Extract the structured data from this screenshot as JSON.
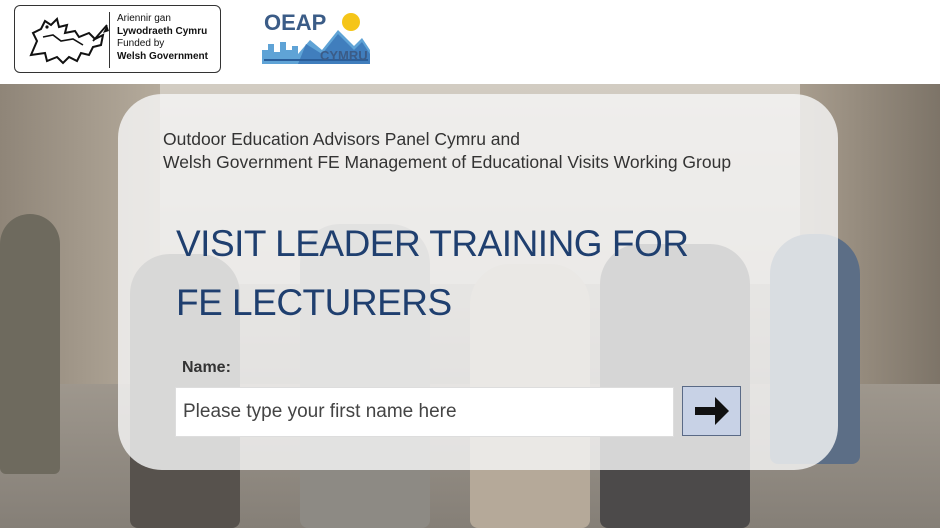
{
  "header": {
    "wg_logo": {
      "line1": "Ariennir gan",
      "line2": "Lywodraeth Cymru",
      "line3": "Funded by",
      "line4": "Welsh Government",
      "icon": "welsh-dragon-icon"
    },
    "oeap_logo": {
      "title": "OEAP",
      "subtitle": "CYMRU",
      "sun_color": "#f5c518",
      "brand_color": "#3b5c87"
    }
  },
  "panel": {
    "subtitle_line1": "Outdoor Education Advisors Panel Cymru and",
    "subtitle_line2": "Welsh Government FE Management of Educational Visits Working Group",
    "title_line1": "VISIT LEADER TRAINING FOR",
    "title_line2": "FE LECTURERS",
    "title_color": "#1f3f6f"
  },
  "form": {
    "name_label": "Name:",
    "name_placeholder": "Please type your first name here",
    "submit_icon": "arrow-right-icon"
  }
}
